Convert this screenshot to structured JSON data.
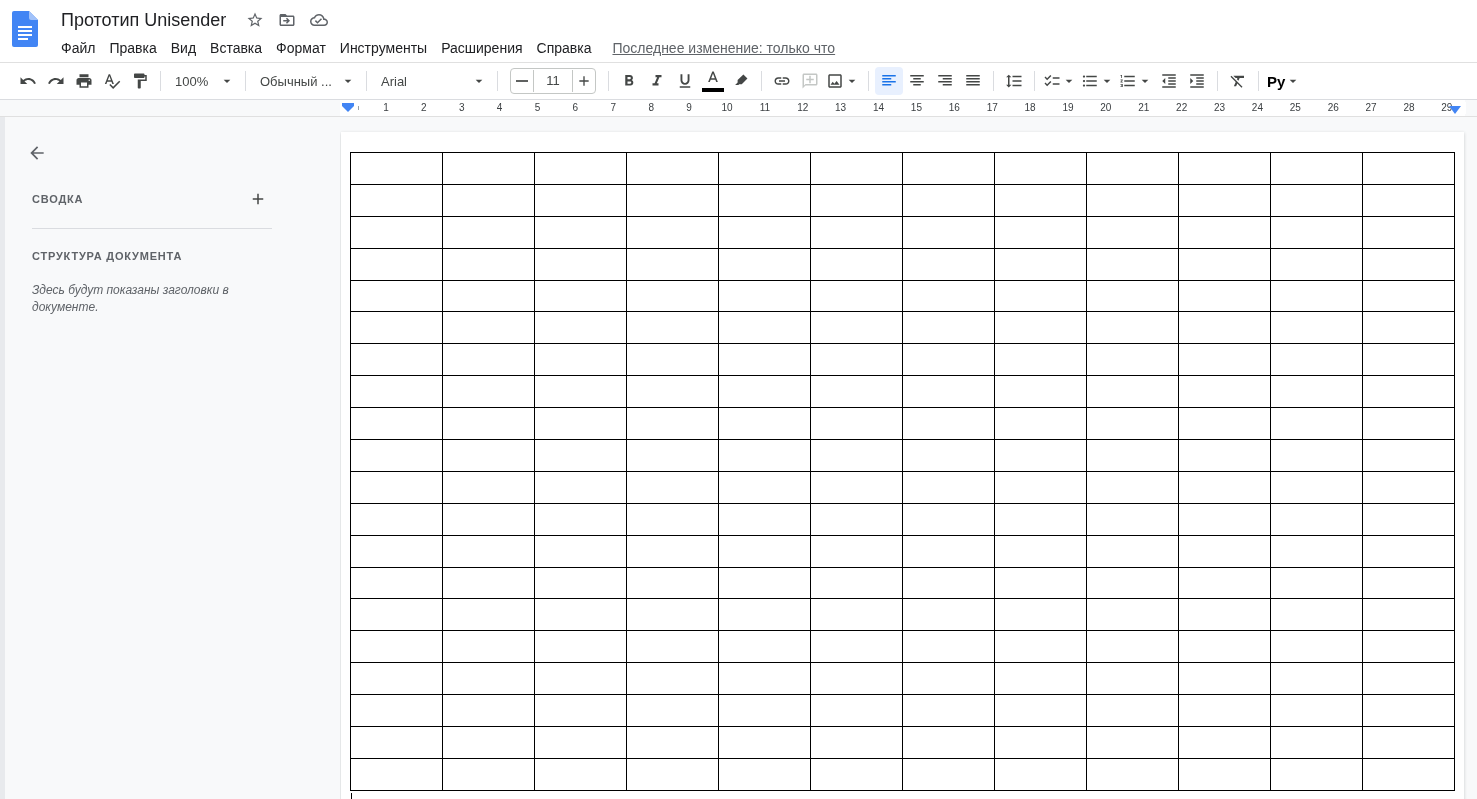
{
  "document_title": "Прототип Unisender",
  "menu": [
    "Файл",
    "Правка",
    "Вид",
    "Вставка",
    "Формат",
    "Инструменты",
    "Расширения",
    "Справка"
  ],
  "last_edit": "Последнее изменение: только что",
  "toolbar": {
    "zoom": "100%",
    "style": "Обычный ...",
    "font": "Arial",
    "font_size": "11",
    "input_tools": "Ру",
    "insert": [
      {
        "kind": "link",
        "disabled": false
      },
      {
        "kind": "comment",
        "disabled": true
      },
      {
        "kind": "image",
        "disabled": false
      }
    ],
    "alignment": [
      {
        "kind": "left",
        "selected": true
      },
      {
        "kind": "center",
        "selected": false
      },
      {
        "kind": "right",
        "selected": false
      },
      {
        "kind": "justify",
        "selected": false
      }
    ]
  },
  "ruler": [
    "1",
    "2",
    "3",
    "4",
    "5",
    "6",
    "7",
    "8",
    "9",
    "10",
    "11",
    "12",
    "13",
    "14",
    "15",
    "16",
    "17",
    "18",
    "19",
    "20",
    "21",
    "22",
    "23",
    "24",
    "25",
    "26",
    "27",
    "28",
    "29"
  ],
  "sidebar": {
    "summary": "СВОДКА",
    "outline": "СТРУКТУРА ДОКУМЕНТА",
    "outline_hint": "Здесь будут показаны заголовки в документе."
  }
}
